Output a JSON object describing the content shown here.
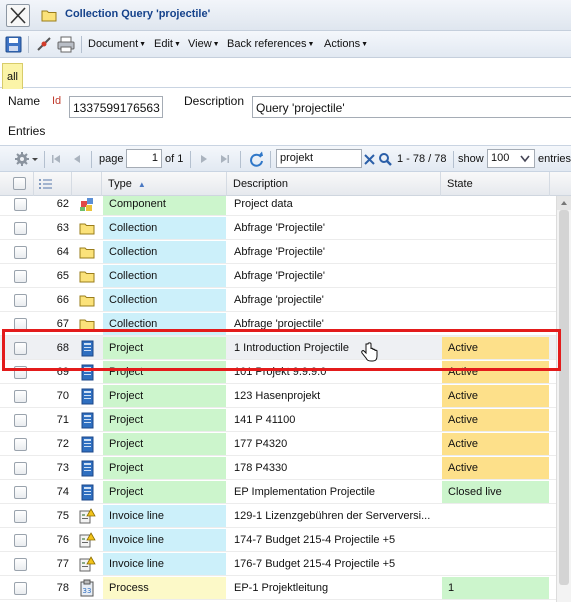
{
  "window": {
    "title": "Collection Query 'projectile'"
  },
  "toolbar": {
    "menus": [
      {
        "label": "Document"
      },
      {
        "label": "Edit"
      },
      {
        "label": "View"
      },
      {
        "label": "Back references"
      },
      {
        "label": "Actions"
      }
    ]
  },
  "tabs": [
    {
      "label": "all"
    }
  ],
  "form": {
    "name_label": "Name",
    "id_label": "Id",
    "id_value": "1337599176563",
    "description_label": "Description",
    "description_value": "Query 'projectile'",
    "entries_label": "Entries"
  },
  "pager": {
    "page_label": "page",
    "page_value": "1",
    "of_label": "of 1",
    "search_value": "projekt",
    "range_text": "1 - 78 / 78",
    "show_label": "show",
    "page_size": "100",
    "entries_label": "entries"
  },
  "grid": {
    "columns": [
      {
        "label": "Type",
        "sorted": "asc"
      },
      {
        "label": "Description"
      },
      {
        "label": "State"
      }
    ],
    "rows": [
      {
        "num": "62",
        "icon": "component-icon",
        "type": "Component",
        "type_color": "#ccf5cc",
        "description": "Project data",
        "state": "",
        "state_color": ""
      },
      {
        "num": "63",
        "icon": "folder-icon",
        "type": "Collection",
        "type_color": "#ccf0fa",
        "description": "Abfrage 'Projectile'",
        "state": "",
        "state_color": ""
      },
      {
        "num": "64",
        "icon": "folder-icon",
        "type": "Collection",
        "type_color": "#ccf0fa",
        "description": "Abfrage 'Projectile'",
        "state": "",
        "state_color": ""
      },
      {
        "num": "65",
        "icon": "folder-icon",
        "type": "Collection",
        "type_color": "#ccf0fa",
        "description": "Abfrage 'Projectile'",
        "state": "",
        "state_color": ""
      },
      {
        "num": "66",
        "icon": "folder-icon",
        "type": "Collection",
        "type_color": "#ccf0fa",
        "description": "Abfrage 'projectile'",
        "state": "",
        "state_color": ""
      },
      {
        "num": "67",
        "icon": "folder-icon",
        "type": "Collection",
        "type_color": "#ccf0fa",
        "description": "Abfrage 'projectile'",
        "state": "",
        "state_color": ""
      },
      {
        "num": "68",
        "icon": "project-icon",
        "type": "Project",
        "type_color": "#ccf5cc",
        "description": "1 Introduction Projectile",
        "state": "Active",
        "state_color": "#fde08a",
        "hover": true
      },
      {
        "num": "69",
        "icon": "project-icon",
        "type": "Project",
        "type_color": "#ccf5cc",
        "description": "101 Projekt 9.9.9.0",
        "state": "Active",
        "state_color": "#fde08a"
      },
      {
        "num": "70",
        "icon": "project-icon",
        "type": "Project",
        "type_color": "#ccf5cc",
        "description": "123 Hasenprojekt",
        "state": "Active",
        "state_color": "#fde08a"
      },
      {
        "num": "71",
        "icon": "project-icon",
        "type": "Project",
        "type_color": "#ccf5cc",
        "description": "141 P 41100",
        "state": "Active",
        "state_color": "#fde08a"
      },
      {
        "num": "72",
        "icon": "project-icon",
        "type": "Project",
        "type_color": "#ccf5cc",
        "description": "177 P4320",
        "state": "Active",
        "state_color": "#fde08a"
      },
      {
        "num": "73",
        "icon": "project-icon",
        "type": "Project",
        "type_color": "#ccf5cc",
        "description": "178 P4330",
        "state": "Active",
        "state_color": "#fde08a"
      },
      {
        "num": "74",
        "icon": "project-icon",
        "type": "Project",
        "type_color": "#ccf5cc",
        "description": "EP Implementation Projectile",
        "state": "Closed live",
        "state_color": "#ccf5cc"
      },
      {
        "num": "75",
        "icon": "invoice-line-icon",
        "type": "Invoice line",
        "type_color": "#ccf0fa",
        "description": "129-1 Lizenzgebühren der Serverversi...",
        "state": "",
        "state_color": ""
      },
      {
        "num": "76",
        "icon": "invoice-line-icon",
        "type": "Invoice line",
        "type_color": "#ccf0fa",
        "description": "174-7 Budget 215-4 Projectile +5",
        "state": "",
        "state_color": ""
      },
      {
        "num": "77",
        "icon": "invoice-line-icon",
        "type": "Invoice line",
        "type_color": "#ccf0fa",
        "description": "176-7 Budget 215-4 Projectile +5",
        "state": "",
        "state_color": ""
      },
      {
        "num": "78",
        "icon": "process-icon",
        "type": "Process",
        "type_color": "#fcf9c8",
        "description": "EP-1 Projektleitung",
        "state": "1",
        "state_color": "#ccf5cc"
      }
    ]
  },
  "colors": {
    "title_text": "#15428b",
    "highlight_box": "#e31b1b",
    "active_state": "#fde08a",
    "type_green": "#ccf5cc",
    "type_blue": "#ccf0fa"
  }
}
